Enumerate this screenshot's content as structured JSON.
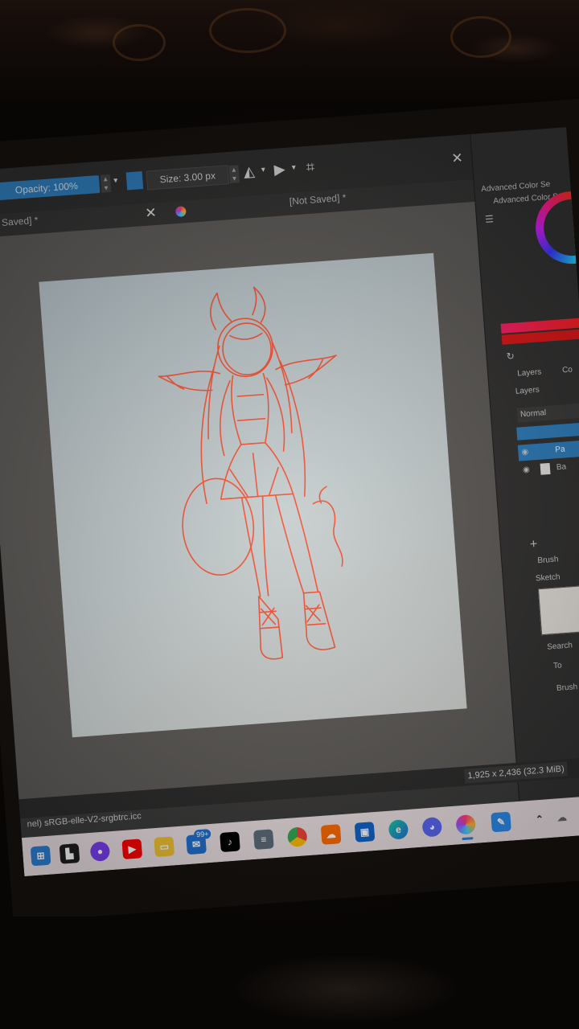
{
  "toolbar": {
    "opacity_label": "Opacity: 100%",
    "size_label": "Size: 3.00 px",
    "mirror_h_icon": "mirror-horizontal-icon",
    "mirror_v_icon": "mirror-vertical-icon",
    "crop_icon": "crop-icon",
    "close_glyph": "✕"
  },
  "tabs": {
    "tab1_title": "[Not Saved]",
    "tab1_marker": "*",
    "tab2_title": "[Not Saved]",
    "tab2_marker": "*",
    "close_glyph": "✕"
  },
  "docker": {
    "advanced_color_title": "Advanced Color Se",
    "advanced_color_sub": "Advanced Color S",
    "layers_tab": "Layers",
    "layers_tab2": "Co",
    "layers_header": "Layers",
    "blend_mode": "Normal",
    "layer1_name": "Pa",
    "layer2_name": "Ba",
    "brush_header": "Brush",
    "brush_tag": "Sketch",
    "search_label": "Search",
    "tag_label": "To",
    "brush_footer": "Brush"
  },
  "status": {
    "dimensions": "1,925 x 2,436 (32.3 MiB)",
    "color_profile": "nel)  sRGB-elle-V2-srgbtrc.icc"
  },
  "taskbar": {
    "badge_count": "99+",
    "icons": [
      "start-icon",
      "taskview-icon",
      "zoom-icon",
      "youtube-icon",
      "file-explorer-icon",
      "mail-icon",
      "tiktok-icon",
      "news-icon",
      "chrome-icon",
      "soundcloud-icon",
      "store-icon",
      "edge-icon",
      "discord-icon",
      "krita-icon",
      "pen-app-icon"
    ]
  },
  "colors": {
    "accent": "#2f7fbf",
    "sketch": "#ff4a2a",
    "panel": "#323232",
    "taskbar": "#e9dfe2"
  }
}
